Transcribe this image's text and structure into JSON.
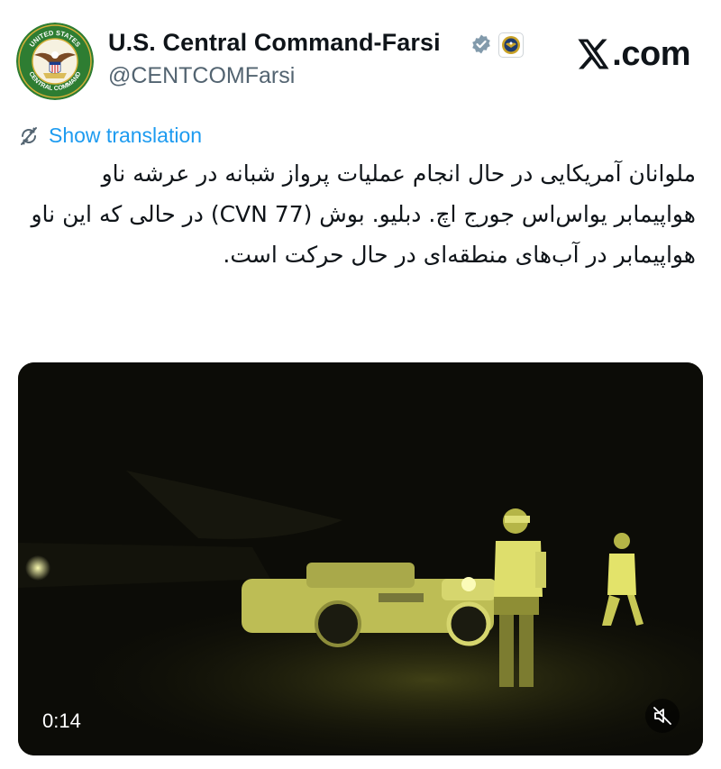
{
  "account": {
    "display_name": "U.S. Central Command-Farsi",
    "handle": "@CENTCOMFarsi",
    "avatar_icon": "united-states-central-command-seal-icon",
    "avatar_text_top": "UNITED STATES",
    "avatar_text_bottom": "CENTRAL COMMAND",
    "verified_icon": "verified-badge-icon",
    "verified_color": "#829aab",
    "affiliation_icon": "department-of-defense-seal-icon"
  },
  "site": {
    "logo_icon": "x-logo-icon",
    "name": ".com"
  },
  "translate": {
    "icon": "translate-icon",
    "label": "Show translation",
    "color": "#1d9bf0"
  },
  "tweet": {
    "text": "ملوانان آمریکایی در حال انجام عملیات پرواز شبانه در عرشه ناو هواپیمابر یواس‌اس جورج اچ. دبلیو. بوش (CVN 77) در حالی که این ناو هواپیمابر در آب‌های منطقه‌ای در حال حرکت است."
  },
  "video": {
    "timestamp": "0:14",
    "mute_icon": "muted-speaker-icon",
    "tint_color": "#e4e36a"
  }
}
